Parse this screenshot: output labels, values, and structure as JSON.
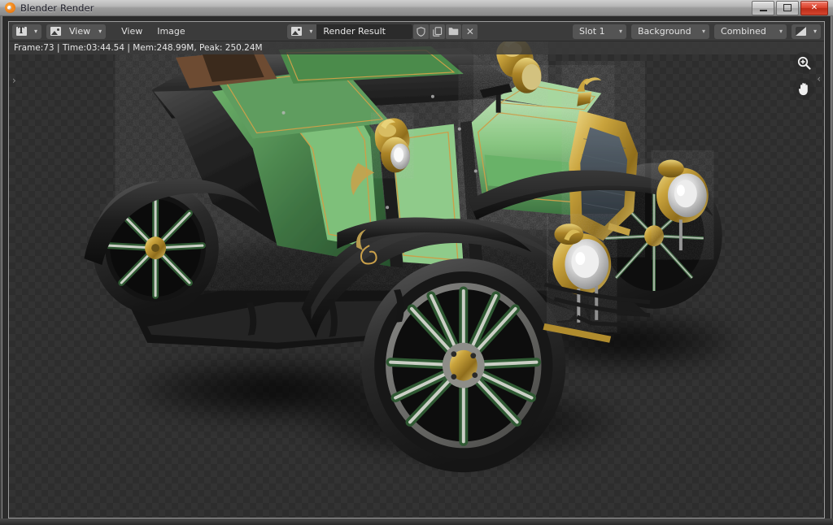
{
  "window": {
    "title": "Blender Render",
    "logo_icon": "blender-logo-icon",
    "minimize_label": "Minimize",
    "maximize_label": "Maximize",
    "close_label": "✕"
  },
  "header": {
    "editor_type_icon": "editor-type-icon",
    "editor_type_chevron": "▾",
    "view_mode_icon": "image-editor-icon",
    "view_mode_label": "View",
    "view_mode_chevron": "▾",
    "menus": [
      {
        "label": "View"
      },
      {
        "label": "Image"
      }
    ],
    "datablock": {
      "icon": "image-datablock-icon",
      "chevron": "▾",
      "name": "Render Result",
      "fake_user_icon": "shield-icon",
      "new_image_icon": "copy-icon",
      "open_image_icon": "folder-icon",
      "unlink_icon": "✕"
    },
    "slot": {
      "label": "Slot 1",
      "arrow": "▾"
    },
    "pass_source": {
      "label": "Background",
      "arrow": "▾"
    },
    "pass": {
      "label": "Combined",
      "arrow": "▾"
    },
    "display_mode": {
      "icon": "display-channel-icon",
      "arrow": "▾"
    }
  },
  "canvas": {
    "stats": "Frame:73 | Time:03:44.54 | Mem:248.99M, Peak: 250.24M",
    "left_collapse_arrow": "›",
    "right_collapse_arrow": "‹",
    "zoom_tool_icon": "zoom-in-icon",
    "pan_tool_icon": "hand-pan-icon",
    "alpha_checker_color_a": "#2d2d2d",
    "alpha_checker_color_b": "#333333"
  },
  "render": {
    "subject": "vintage brass-era automobile",
    "body_color": "#7ec07a",
    "body_color_dark": "#2f5a33",
    "fender_color": "#1a1a1a",
    "brass_color": "#b8922f",
    "brass_light": "#e3c862",
    "tire_color": "#2a2a2a",
    "rim_color": "#c9c9c4",
    "spoke_green": "#1f4423",
    "pinstripe_color": "#caa04a",
    "glass_color": "#3a4a52",
    "shadow_color": "#0b0b0b"
  },
  "colors": {
    "header_bg": "#3b3b3b",
    "widget_bg": "#545454",
    "field_bg": "#2b2b2b",
    "text": "#e0e0e0",
    "titlebar_text": "#1d1d28",
    "close_button": "#d9412b",
    "blender_orange": "#f2881f"
  }
}
